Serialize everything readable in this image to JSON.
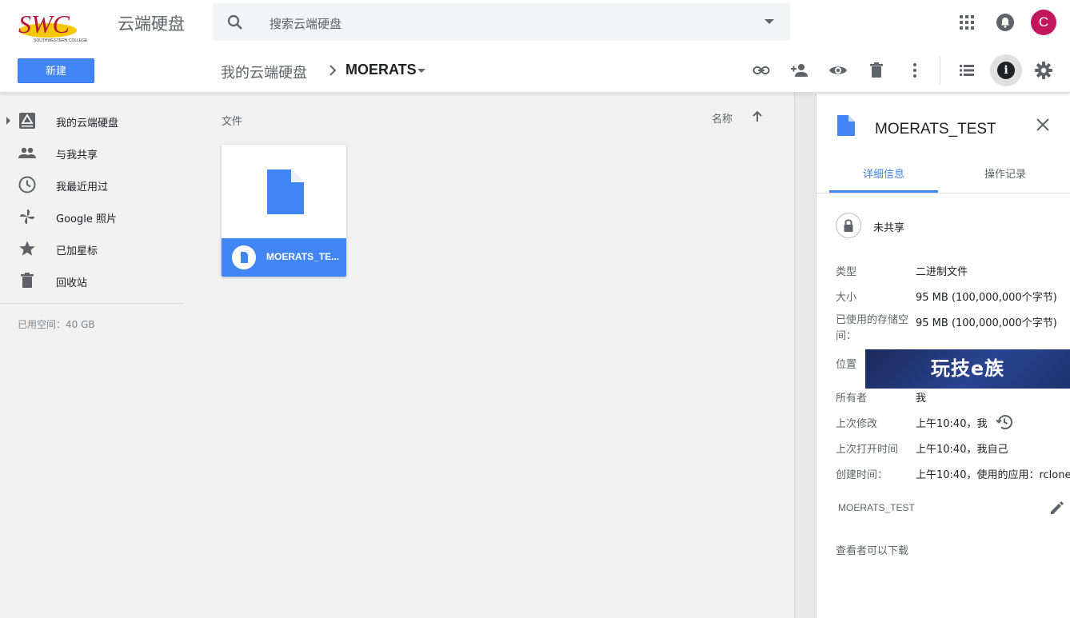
{
  "header": {
    "logo_text": "SWC",
    "logo_subtext": "SOUTHWESTERN COLLEGE",
    "app_name": "云端硬盘",
    "search_placeholder": "搜索云端硬盘",
    "avatar_letter": "C"
  },
  "toolbar": {
    "new_label": "新建",
    "breadcrumb_root": "我的云端硬盘",
    "breadcrumb_current": "MOERATS",
    "info_glyph": "i",
    "icons": [
      "link-icon",
      "share-person-icon",
      "preview-eye-icon",
      "trash-icon",
      "more-vert-icon",
      "list-view-icon",
      "info-icon",
      "settings-gear-icon"
    ]
  },
  "sidebar": {
    "items": [
      {
        "label": "我的云端硬盘",
        "icon": "drive-icon"
      },
      {
        "label": "与我共享",
        "icon": "people-icon"
      },
      {
        "label": "我最近用过",
        "icon": "clock-icon"
      },
      {
        "label": "Google 照片",
        "icon": "photos-pinwheel-icon"
      },
      {
        "label": "已加星标",
        "icon": "star-icon"
      },
      {
        "label": "回收站",
        "icon": "trash-icon"
      }
    ],
    "storage": "已用空间：40 GB"
  },
  "main": {
    "section_label": "文件",
    "sort_label": "名称",
    "files": [
      {
        "name": "MOERATS_TE...",
        "icon": "file-icon"
      }
    ]
  },
  "details": {
    "title": "MOERATS_TEST",
    "tabs": [
      "详细信息",
      "操作记录"
    ],
    "sharing": "未共享",
    "rows": {
      "type_key": "类型",
      "type_val": "二进制文件",
      "size_key": "大小",
      "size_val": "95 MB (100,000,000个字节)",
      "storage_key": "已使用的存储空间：",
      "storage_val": "95 MB (100,000,000个字节)",
      "location_key": "位置",
      "location_banner": "玩技e族",
      "owner_key": "所有者",
      "owner_val": "我",
      "modified_key": "上次修改",
      "modified_val": "上午10:40，我",
      "opened_key": "上次打开时间",
      "opened_val": "上午10:40，我自己",
      "created_key": "创建时间：",
      "created_val": "上午10:40，使用的应用：rclone"
    },
    "description": "MOERATS_TEST",
    "viewers": "查看者可以下载"
  },
  "colors": {
    "accent": "#4285f4",
    "avatar": "#c2185b",
    "sidebar_bg": "#f1f1f1",
    "banner": "#2a4492"
  }
}
